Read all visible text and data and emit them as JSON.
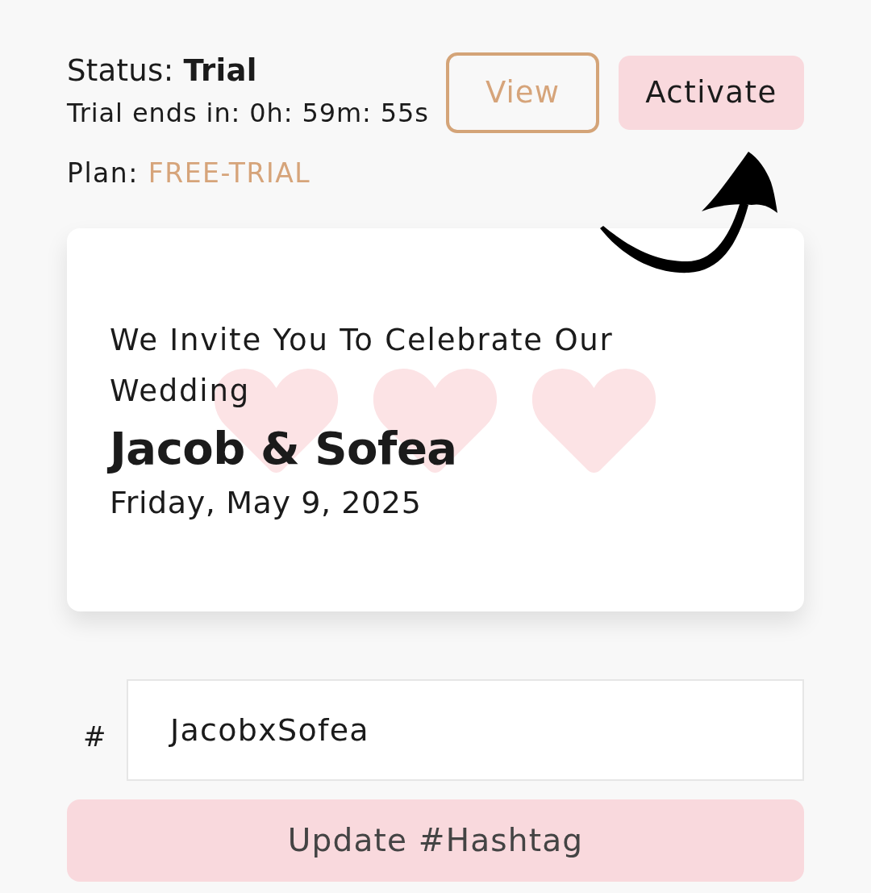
{
  "status": {
    "text": "Status: **Trial**",
    "countdown": "Trial ends in: 0h: 59m: 55s"
  },
  "plan": {
    "label": "Plan:",
    "value": "FREE-TRIAL"
  },
  "buttons": [
    {
      "label": "View",
      "kind": "outline"
    },
    {
      "label": "Activate",
      "kind": "filled"
    }
  ],
  "invitation_card": {
    "invite_line": "We Invite You To Celebrate Our Wedding",
    "couple": "Jacob & Sofea",
    "date": "Friday, May 9, 2025"
  },
  "hashtag": {
    "prefix": "#",
    "value": "JacobxSofea"
  },
  "update_button": "Update #Hashtag"
}
